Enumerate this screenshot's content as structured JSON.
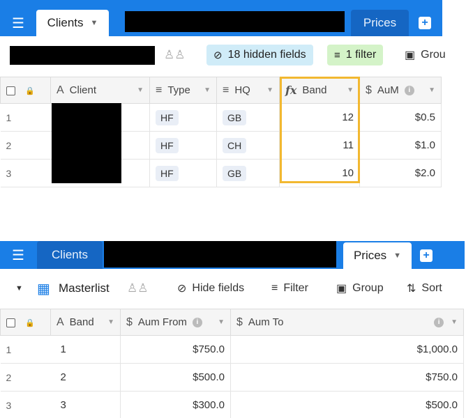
{
  "panel1": {
    "tabs": {
      "active": "Clients",
      "other": "Prices"
    },
    "toolbar": {
      "hidden_fields": "18 hidden fields",
      "filter": "1 filter",
      "group": "Grou"
    },
    "columns": {
      "client": "Client",
      "type": "Type",
      "hq": "HQ",
      "band": "Band",
      "aum": "AuM"
    },
    "rows": [
      {
        "num": "1",
        "type": "HF",
        "hq": "GB",
        "band": "12",
        "aum": "$0.5"
      },
      {
        "num": "2",
        "type": "HF",
        "hq": "CH",
        "band": "11",
        "aum": "$1.0"
      },
      {
        "num": "3",
        "type": "HF",
        "hq": "GB",
        "band": "10",
        "aum": "$2.0"
      }
    ]
  },
  "panel2": {
    "tabs": {
      "other": "Clients",
      "active": "Prices"
    },
    "toolbar": {
      "view_name": "Masterlist",
      "hide_fields": "Hide fields",
      "filter": "Filter",
      "group": "Group",
      "sort": "Sort"
    },
    "columns": {
      "band": "Band",
      "aum_from": "Aum From",
      "aum_to": "Aum To"
    },
    "rows": [
      {
        "num": "1",
        "band": "1",
        "aum_from": "$750.0",
        "aum_to": "$1,000.0"
      },
      {
        "num": "2",
        "band": "2",
        "aum_from": "$500.0",
        "aum_to": "$750.0"
      },
      {
        "num": "3",
        "band": "3",
        "aum_from": "$300.0",
        "aum_to": "$500.0"
      }
    ]
  },
  "colors": {
    "brand_blue": "#1a7ee6",
    "hidden_fields_bg": "#d0ecf8",
    "filter_bg": "#d4f3c8",
    "highlight": "#f2b830"
  }
}
